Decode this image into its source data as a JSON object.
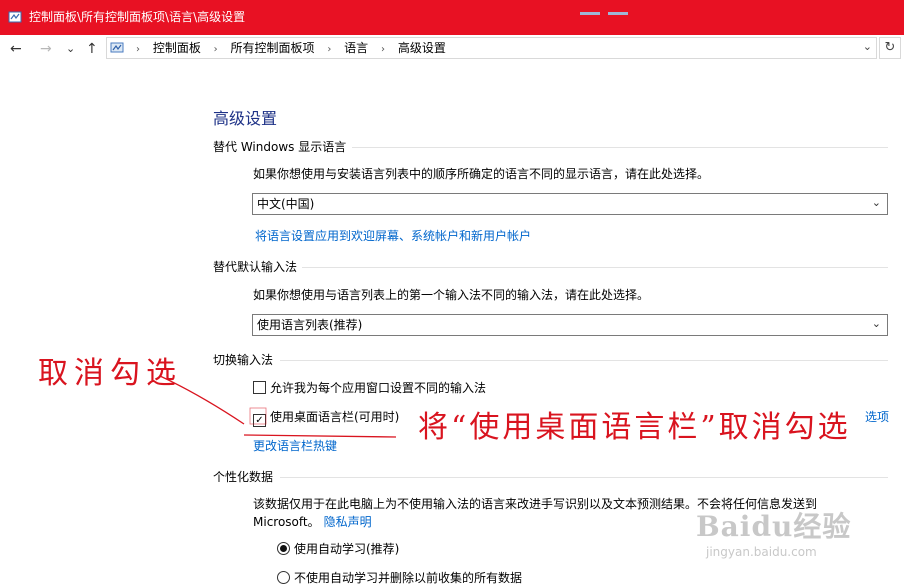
{
  "window": {
    "title": "控制面板\\所有控制面板项\\语言\\高级设置"
  },
  "nav": {
    "back": "←",
    "forward": "→",
    "recent": "⌄",
    "up": "↑",
    "breadcrumbs": [
      "控制面板",
      "所有控制面板项",
      "语言",
      "高级设置"
    ],
    "refresh": "↻",
    "dropdown": "⌄"
  },
  "page": {
    "title": "高级设置"
  },
  "sections": {
    "display_lang": {
      "heading": "替代 Windows 显示语言",
      "description": "如果你想使用与安装语言列表中的顺序所确定的语言不同的显示语言，请在此处选择。",
      "selected": "中文(中国)",
      "link": "将语言设置应用到欢迎屏幕、系统帐户和新用户帐户"
    },
    "default_input": {
      "heading": "替代默认输入法",
      "description": "如果你想使用与语言列表上的第一个输入法不同的输入法，请在此处选择。",
      "selected": "使用语言列表(推荐)"
    },
    "switch_input": {
      "heading": "切换输入法",
      "checkbox1": {
        "label": "允许我为每个应用窗口设置不同的输入法",
        "checked": false
      },
      "checkbox2": {
        "label": "使用桌面语言栏(可用时)",
        "checked": true
      },
      "options_link": "选项",
      "hotkey_link": "更改语言栏热键"
    },
    "personalization": {
      "heading": "个性化数据",
      "description_line1": "该数据仅用于在此电脑上为不使用输入法的语言来改进手写识别以及文本预测结果。不会将任何信息发送到",
      "description_line2": "Microsoft。",
      "privacy_link": "隐私声明",
      "radio1": {
        "label": "使用自动学习(推荐)",
        "selected": true
      },
      "radio2": {
        "label": "不使用自动学习并删除以前收集的所有数据",
        "selected": false
      }
    }
  },
  "annotations": {
    "left": "取消勾选",
    "right": "将“使用桌面语言栏”取消勾选",
    "color": "#d9141f"
  },
  "watermark": {
    "brand": "Baidu经验",
    "url": "jingyan.baidu.com"
  },
  "colors": {
    "titlebar": "#e81123",
    "link": "#0066cc",
    "heading": "#1e3287"
  }
}
